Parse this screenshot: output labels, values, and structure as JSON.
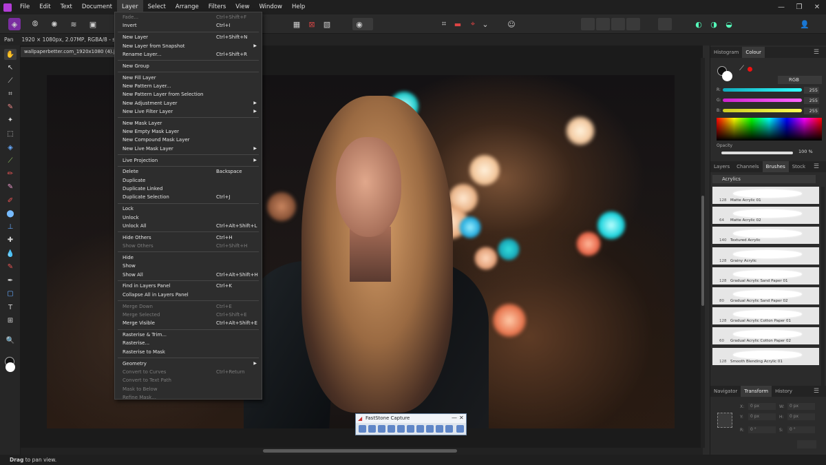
{
  "menubar": {
    "items": [
      "File",
      "Edit",
      "Text",
      "Document",
      "Layer",
      "Select",
      "Arrange",
      "Filters",
      "View",
      "Window",
      "Help"
    ],
    "active": "Layer",
    "window_controls": [
      "—",
      "❐",
      "✕"
    ]
  },
  "context_bar": {
    "tool": "Pan",
    "doc_info": "1920 × 1080px, 2.07MP, RGBA/8 - sRGB"
  },
  "document_tab": {
    "name": "wallpaperbetter.com_1920x1080 (4).jpg (76"
  },
  "layer_menu": [
    {
      "label": "Fade...",
      "shortcut": "Ctrl+Shift+F",
      "disabled": true
    },
    {
      "label": "Invert",
      "shortcut": "Ctrl+I"
    },
    {
      "sep": true
    },
    {
      "label": "New Layer",
      "shortcut": "Ctrl+Shift+N"
    },
    {
      "label": "New Layer from Snapshot",
      "submenu": true
    },
    {
      "label": "Rename Layer...",
      "shortcut": "Ctrl+Shift+R"
    },
    {
      "sep": true
    },
    {
      "label": "New Group"
    },
    {
      "sep": true
    },
    {
      "label": "New Fill Layer"
    },
    {
      "label": "New Pattern Layer..."
    },
    {
      "label": "New Pattern Layer from Selection"
    },
    {
      "label": "New Adjustment Layer",
      "submenu": true
    },
    {
      "label": "New Live Filter Layer",
      "submenu": true
    },
    {
      "sep": true
    },
    {
      "label": "New Mask Layer"
    },
    {
      "label": "New Empty Mask Layer"
    },
    {
      "label": "New Compound Mask Layer"
    },
    {
      "label": "New Live Mask Layer",
      "submenu": true
    },
    {
      "sep": true
    },
    {
      "label": "Live Projection",
      "submenu": true
    },
    {
      "sep": true
    },
    {
      "label": "Delete",
      "shortcut": "Backspace"
    },
    {
      "label": "Duplicate"
    },
    {
      "label": "Duplicate Linked"
    },
    {
      "label": "Duplicate Selection",
      "shortcut": "Ctrl+J"
    },
    {
      "sep": true
    },
    {
      "label": "Lock"
    },
    {
      "label": "Unlock"
    },
    {
      "label": "Unlock All",
      "shortcut": "Ctrl+Alt+Shift+L"
    },
    {
      "sep": true
    },
    {
      "label": "Hide Others",
      "shortcut": "Ctrl+H"
    },
    {
      "label": "Show Others",
      "shortcut": "Ctrl+Shift+H",
      "disabled": true
    },
    {
      "sep": true
    },
    {
      "label": "Hide"
    },
    {
      "label": "Show"
    },
    {
      "label": "Show All",
      "shortcut": "Ctrl+Alt+Shift+H"
    },
    {
      "sep": true
    },
    {
      "label": "Find in Layers Panel",
      "shortcut": "Ctrl+K"
    },
    {
      "label": "Collapse All in Layers Panel"
    },
    {
      "sep": true
    },
    {
      "label": "Merge Down",
      "shortcut": "Ctrl+E",
      "disabled": true
    },
    {
      "label": "Merge Selected",
      "shortcut": "Ctrl+Shift+E",
      "disabled": true
    },
    {
      "label": "Merge Visible",
      "shortcut": "Ctrl+Alt+Shift+E"
    },
    {
      "sep": true
    },
    {
      "label": "Rasterise & Trim..."
    },
    {
      "label": "Rasterise..."
    },
    {
      "label": "Rasterise to Mask"
    },
    {
      "sep": true
    },
    {
      "label": "Geometry",
      "submenu": true
    },
    {
      "label": "Convert to Curves",
      "shortcut": "Ctrl+Return",
      "disabled": true
    },
    {
      "label": "Convert to Text Path",
      "disabled": true
    },
    {
      "label": "Mask to Below",
      "disabled": true
    },
    {
      "label": "Refine Mask...",
      "disabled": true
    }
  ],
  "colour_panel": {
    "tabs": [
      "Histogram",
      "Colour"
    ],
    "active_tab": "Colour",
    "mode": "RGB",
    "r": "255",
    "g": "255",
    "b": "255",
    "r_label": "R:",
    "g_label": "G:",
    "b_label": "B:",
    "opacity_label": "Opacity",
    "opacity": "100 %"
  },
  "brushes_panel": {
    "tabs": [
      "Layers",
      "Channels",
      "Brushes",
      "Stock"
    ],
    "active_tab": "Brushes",
    "category": "Acrylics",
    "brushes": [
      {
        "size": "128",
        "name": "Matte Acrylic 01"
      },
      {
        "size": "64",
        "name": "Matte Acrylic 02"
      },
      {
        "size": "140",
        "name": "Textured Acrylic"
      },
      {
        "size": "128",
        "name": "Grainy Acrylic"
      },
      {
        "size": "128",
        "name": "Gradual Acrylic Sand Paper 01"
      },
      {
        "size": "80",
        "name": "Gradual Acrylic Sand Paper 02"
      },
      {
        "size": "128",
        "name": "Gradual Acrylic Cotton Paper 01"
      },
      {
        "size": "60",
        "name": "Gradual Acrylic Cotton Paper 02"
      },
      {
        "size": "128",
        "name": "Smooth Blending Acrylic 01"
      }
    ]
  },
  "transform_panel": {
    "tabs": [
      "Navigator",
      "Transform",
      "History"
    ],
    "active_tab": "Transform",
    "x_label": "X:",
    "x": "0 px",
    "y_label": "Y:",
    "y": "0 px",
    "w_label": "W:",
    "w": "0 px",
    "h_label": "H:",
    "h": "0 px",
    "r_label": "R:",
    "r": "0 °",
    "s_label": "S:",
    "s": "0 °"
  },
  "faststone": {
    "title": "FastStone Capture"
  },
  "status": {
    "bold": "Drag",
    "text": " to pan view."
  },
  "colors": {
    "accent": "#b23dd6",
    "menu_bg": "#2d2d2d",
    "slider_r": "#29d3e8",
    "slider_g": "#e23bd7",
    "slider_b": "#e8e22a"
  }
}
